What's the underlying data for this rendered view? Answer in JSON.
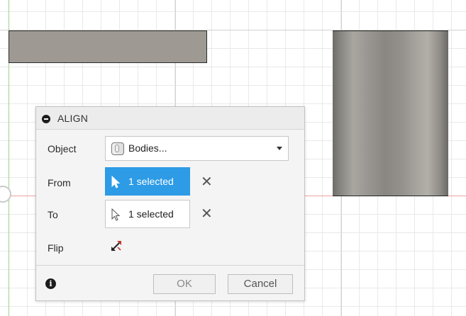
{
  "dialog": {
    "title": "ALIGN",
    "rows": {
      "object": {
        "label": "Object",
        "value": "Bodies..."
      },
      "from": {
        "label": "From",
        "value": "1 selected"
      },
      "to": {
        "label": "To",
        "value": "1 selected"
      },
      "flip": {
        "label": "Flip"
      }
    },
    "clear_symbol": "✕",
    "info_symbol": "i",
    "buttons": {
      "ok": "OK",
      "cancel": "Cancel"
    }
  },
  "colors": {
    "accent": "#2d9be6",
    "x_axis": "#f0a0a0",
    "y_axis": "#9fd28e",
    "body_flat": "#9e9a93"
  },
  "icons": [
    "collapse-icon",
    "body-icon",
    "cursor-arrow-icon",
    "flip-icon",
    "close-icon",
    "info-icon",
    "dropdown-arrow-icon"
  ]
}
